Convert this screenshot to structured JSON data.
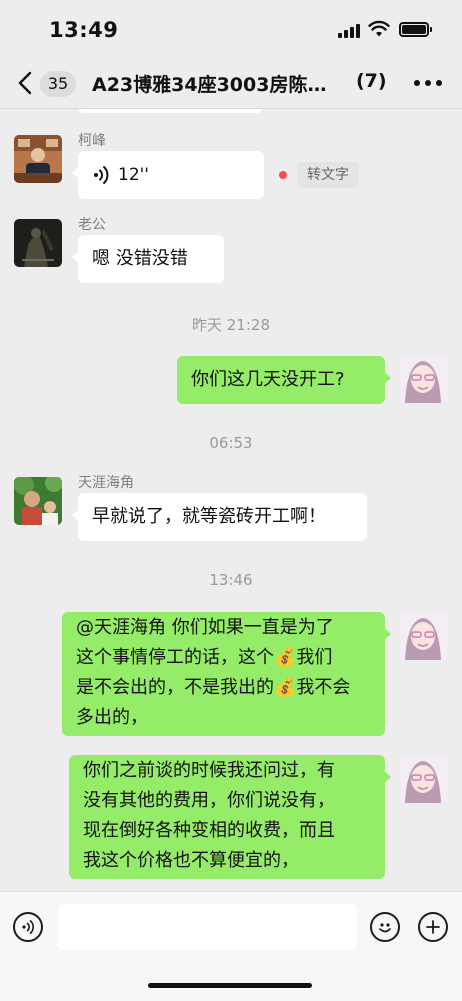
{
  "status_bar": {
    "time": "13:49"
  },
  "nav": {
    "unread_count": "35",
    "title": "A23博雅34座3003房陈…",
    "member_count": "(7)"
  },
  "messages": [
    {
      "type": "voice",
      "sender": "柯峰",
      "duration": "12''",
      "transcribe_label": "转文字"
    },
    {
      "type": "text",
      "sender": "老公",
      "text": "嗯 没错没错"
    },
    {
      "type": "time",
      "text": "昨天 21:28"
    },
    {
      "type": "text",
      "direction": "out",
      "text": "你们这几天没开工?"
    },
    {
      "type": "time",
      "text": "06:53"
    },
    {
      "type": "text",
      "sender": "天涯海角",
      "text": "早就说了，就等瓷砖开工啊！"
    },
    {
      "type": "time",
      "text": "13:46"
    },
    {
      "type": "text",
      "direction": "out",
      "lines": [
        "@天涯海角 你们如果一直是为了",
        "这个事情停工的话，这个💰我们",
        "是不会出的，不是我出的💰我不会",
        "多出的，"
      ]
    },
    {
      "type": "text",
      "direction": "out",
      "lines": [
        "你们之前谈的时候我还问过，有",
        "没有其他的费用，你们说没有，",
        "现在倒好各种变相的收费，而且",
        "我这个价格也不算便宜的，"
      ]
    }
  ],
  "input": {
    "placeholder": ""
  },
  "colors": {
    "outgoing_bubble": "#95ec69",
    "incoming_bubble": "#ffffff",
    "background": "#ededed"
  }
}
